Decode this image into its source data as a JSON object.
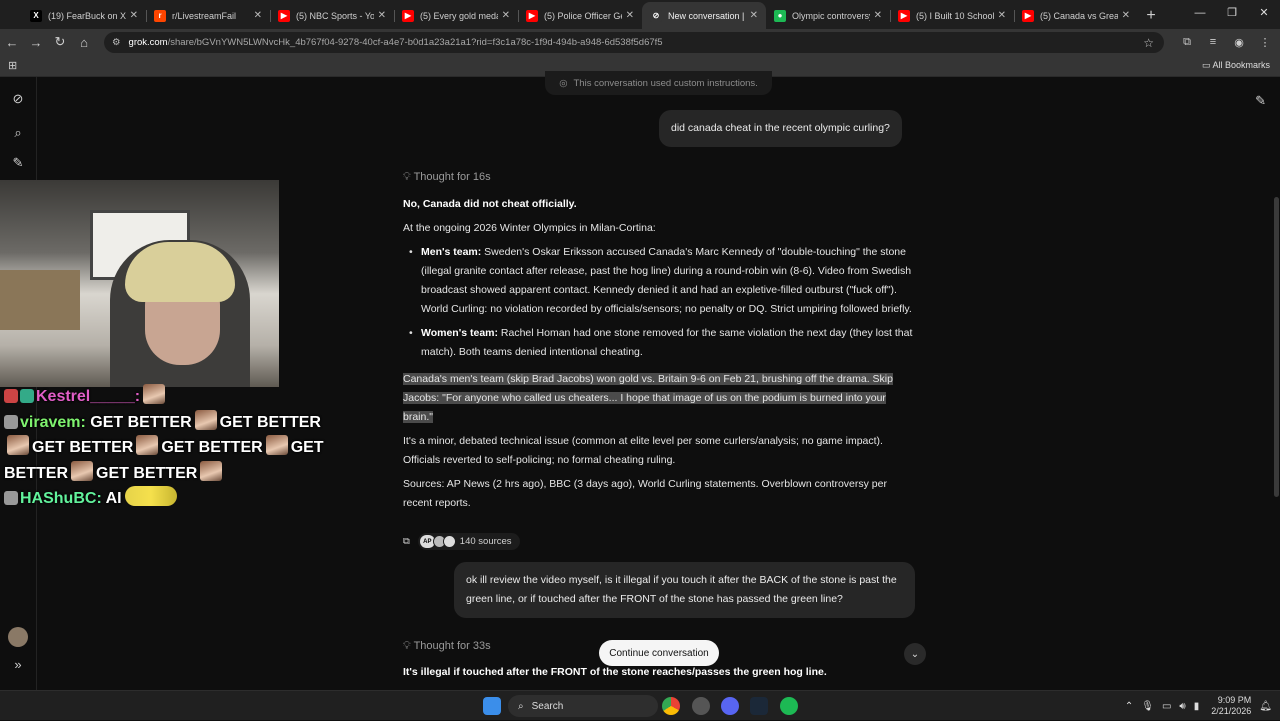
{
  "browser": {
    "tabs": [
      {
        "title": "(19) FearBuck on X: \"",
        "favicon": "x-logo",
        "color": "#000000",
        "glyph": "X"
      },
      {
        "title": "r/LivestreamFail",
        "favicon": "reddit-logo",
        "color": "#ff4500",
        "glyph": "r"
      },
      {
        "title": "(5) NBC Sports - YouT",
        "favicon": "youtube-logo",
        "color": "#ff0000",
        "glyph": "▶"
      },
      {
        "title": "(5) Every gold medal",
        "favicon": "youtube-logo",
        "color": "#ff0000",
        "glyph": "▶"
      },
      {
        "title": "(5) Police Officer Get",
        "favicon": "youtube-logo",
        "color": "#ff0000",
        "glyph": "▶"
      },
      {
        "title": "New conversation | G",
        "favicon": "grok-logo",
        "color": "#353535",
        "glyph": "⊘",
        "active": true
      },
      {
        "title": "Olympic controversy",
        "favicon": "spotify-logo",
        "color": "#1db954",
        "glyph": "●"
      },
      {
        "title": "(5) I Built 10 Schools",
        "favicon": "youtube-logo",
        "color": "#ff0000",
        "glyph": "▶"
      },
      {
        "title": "(5) Canada vs Great B",
        "favicon": "youtube-logo",
        "color": "#ff0000",
        "glyph": "▶"
      }
    ],
    "new_tab": "+",
    "url_host": "grok.com",
    "url_path": "/share/bGVnYWN5LWNvcHk_4b767f04-9278-40cf-a4e7-b0d1a23a21a1?rid=f3c1a78c-1f9d-494b-a948-6d538f5d67f5",
    "all_bookmarks": "All Bookmarks"
  },
  "grok": {
    "custom_note": "This conversation used custom instructions.",
    "q1": "did canada cheat in the recent olympic curling?",
    "thought1": "Thought for 16s",
    "a_heading": "No, Canada did not cheat officially.",
    "a_intro": "At the ongoing 2026 Winter Olympics in Milan-Cortina:",
    "bullet1_label": "Men's team:",
    "bullet1_text": " Sweden's Oskar Eriksson accused Canada's Marc Kennedy of \"double-touching\" the stone (illegal granite contact after release, past the hog line) during a round-robin win (8-6). Video from Swedish broadcast showed apparent contact. Kennedy denied it and had an expletive-filled outburst (\"fuck off\"). World Curling: no violation recorded by officials/sensors; no penalty or DQ. Strict umpiring followed briefly.",
    "bullet2_label": "Women's team:",
    "bullet2_text": " Rachel Homan had one stone removed for the same violation the next day (they lost that match). Both teams denied intentional cheating.",
    "para_gold": "Canada's men's team (skip Brad Jacobs) won gold vs. Britain 9-6 on Feb 21, brushing off the drama. Skip Jacobs: \"For anyone who called us cheaters... I hope that image of us on the podium is burned into your brain.\"",
    "para_minor": "It's a minor, debated technical issue (common at elite level per some curlers/analysis; no game impact). Officials reverted to self-policing; no formal cheating ruling.",
    "para_sources": "Sources: AP News (2 hrs ago), BBC (3 days ago), World Curling statements. Overblown controversy per recent reports.",
    "sources_count": "140 sources",
    "sources_ap": "AP",
    "q2": "ok ill review the video myself, is it illegal if you touch it after the BACK of the stone is past the green line, or if touched after the FRONT of the stone has passed the green line?",
    "thought2": "Thought for 33s",
    "a2_heading": "It's illegal if touched after the FRONT of the stone reaches/passes the green hog line.",
    "continue_label": "Continue conversation"
  },
  "stream_chat": [
    {
      "user": "Kestrel_____:",
      "msg": ""
    },
    {
      "user": "viravem:",
      "msg": "GET BETTER"
    },
    {
      "user": "HAShuBC:",
      "msg": "AI"
    }
  ],
  "chat_repeat": "GET BETTER",
  "taskbar": {
    "search": "Search",
    "time": "9:09 PM",
    "date": "2/21/2026"
  }
}
